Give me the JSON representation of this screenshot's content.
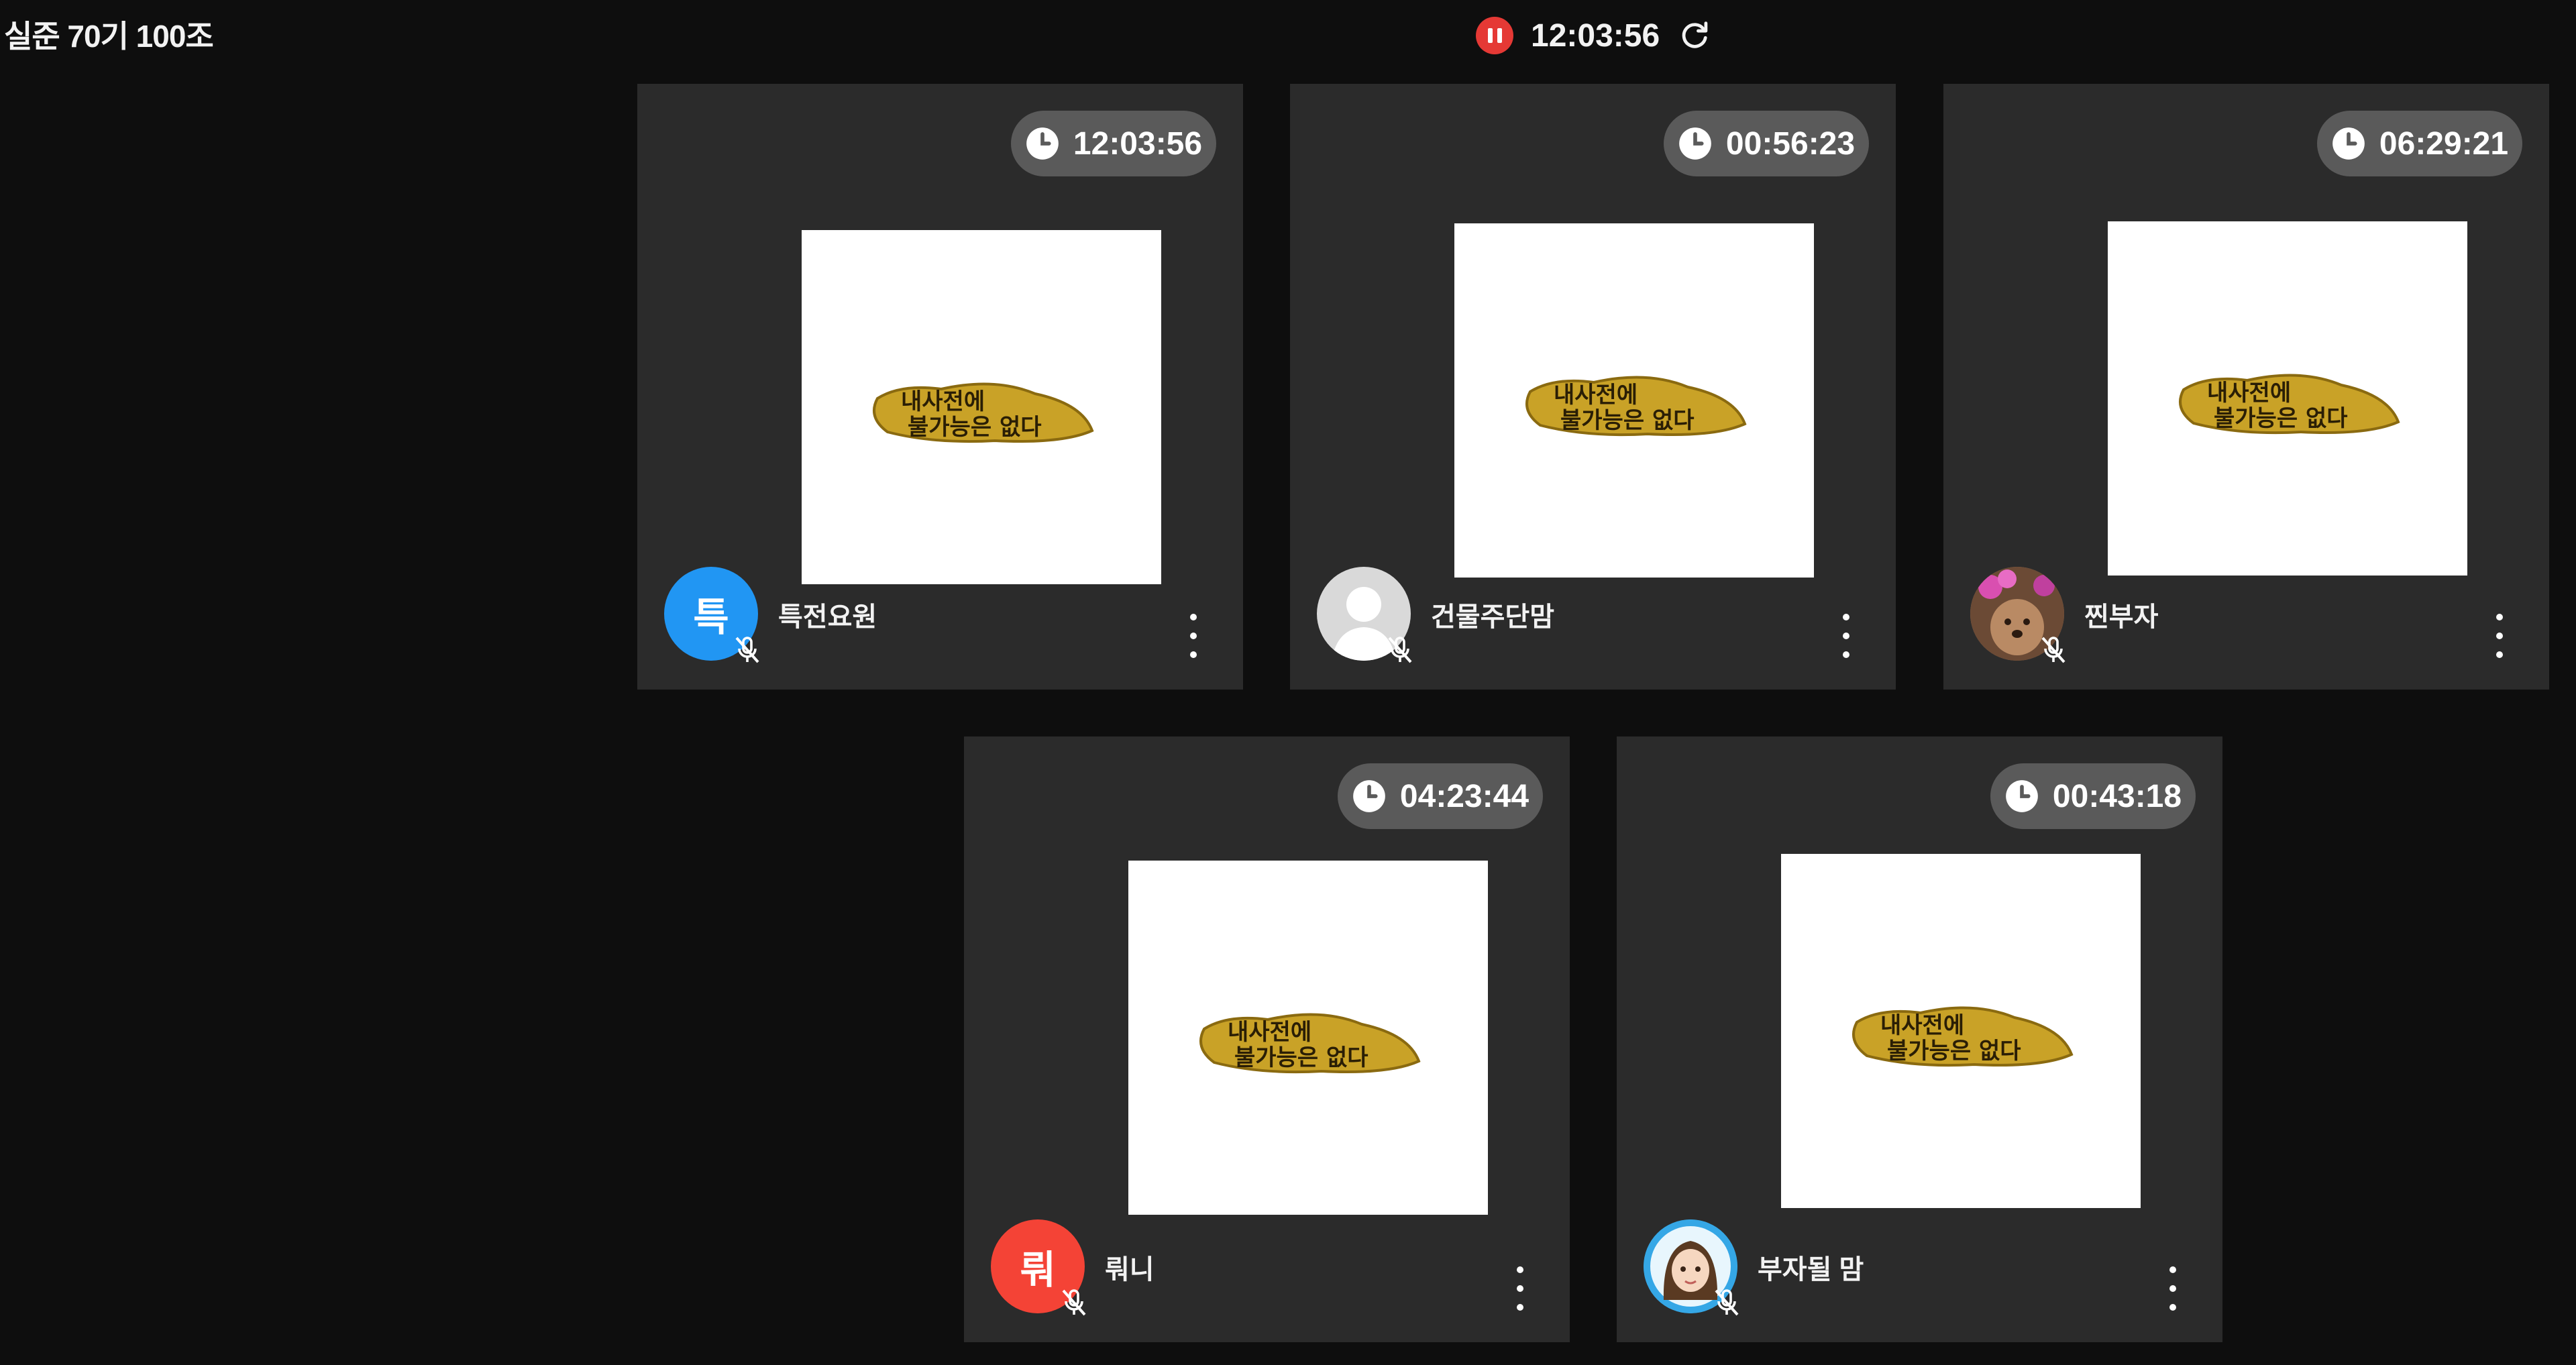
{
  "room": {
    "title": "실준 70기 100조"
  },
  "session": {
    "elapsed": "12:03:56",
    "status": "recording"
  },
  "participants": [
    {
      "name": "특전요원",
      "timer": "12:03:56",
      "avatar_text": "특",
      "avatar_color": "#2196f3",
      "avatar_kind": "initial",
      "muted": true
    },
    {
      "name": "건물주단맘",
      "timer": "00:56:23",
      "avatar_text": "",
      "avatar_color": "#d9d9d9",
      "avatar_kind": "default-person",
      "muted": true
    },
    {
      "name": "찐부자",
      "timer": "06:29:21",
      "avatar_text": "",
      "avatar_color": "#a0765a",
      "avatar_kind": "photo-dog-flowers",
      "muted": true
    },
    {
      "name": "뤄니",
      "timer": "04:23:44",
      "avatar_text": "뤄",
      "avatar_color": "#f44336",
      "avatar_kind": "initial",
      "muted": true
    },
    {
      "name": "부자될 맘",
      "timer": "00:43:18",
      "avatar_text": "",
      "avatar_color": "#35a7e6",
      "avatar_kind": "photo-cartoon-woman",
      "muted": true
    }
  ],
  "thumbnail_text": {
    "line1": "내사전에",
    "line2": "불가능은 없다"
  },
  "colors": {
    "background": "#0e0e0e",
    "tile": "#2b2b2b",
    "timer_pill": "#5a5a5a",
    "record": "#e53935"
  }
}
